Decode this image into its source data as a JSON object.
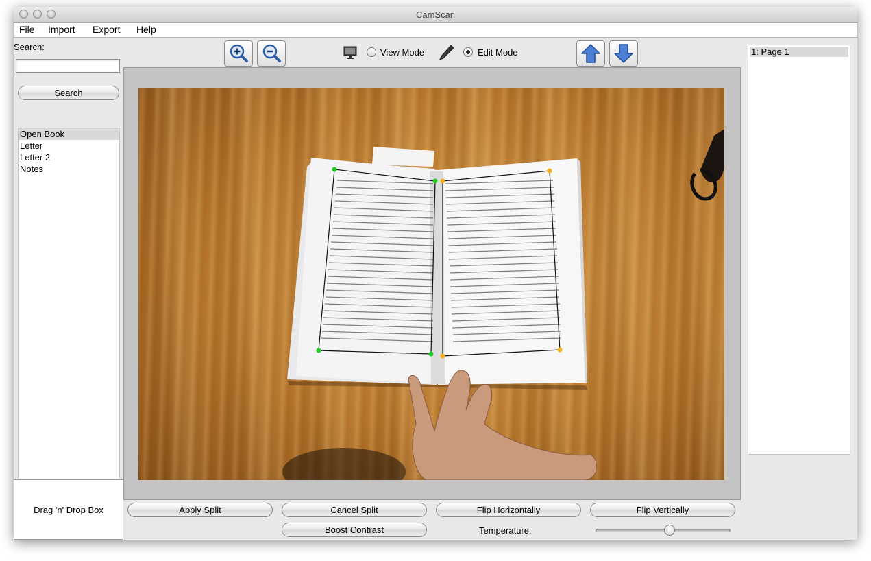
{
  "window": {
    "title": "CamScan"
  },
  "menu": [
    "File",
    "Import",
    "Export",
    "Help"
  ],
  "search": {
    "label": "Search:",
    "value": "",
    "button_label": "Search"
  },
  "documents": {
    "items": [
      "Open Book",
      "Letter",
      "Letter 2",
      "Notes"
    ],
    "selected": "Open Book"
  },
  "dropbox": {
    "label": "Drag 'n' Drop Box"
  },
  "toolbar": {
    "zoom_in_icon": "zoom-in-icon",
    "zoom_out_icon": "zoom-out-icon",
    "view_mode_label": "View Mode",
    "edit_mode_label": "Edit Mode",
    "selected_mode": "Edit Mode",
    "move_up_icon": "arrow-up-icon",
    "move_down_icon": "arrow-down-icon"
  },
  "pages": {
    "items": [
      "1: Page 1"
    ],
    "selected": "1: Page 1"
  },
  "actions": {
    "apply_split": "Apply Split",
    "cancel_split": "Cancel Split",
    "flip_horizontally": "Flip Horizontally",
    "flip_vertically": "Flip Vertically",
    "boost_contrast": "Boost Contrast",
    "temperature_label": "Temperature:"
  },
  "temperature": {
    "value": 0.55
  },
  "colors": {
    "accent_arrow": "#4a7fd4",
    "corner_left": "#22cc22",
    "corner_right": "#f0b020"
  }
}
